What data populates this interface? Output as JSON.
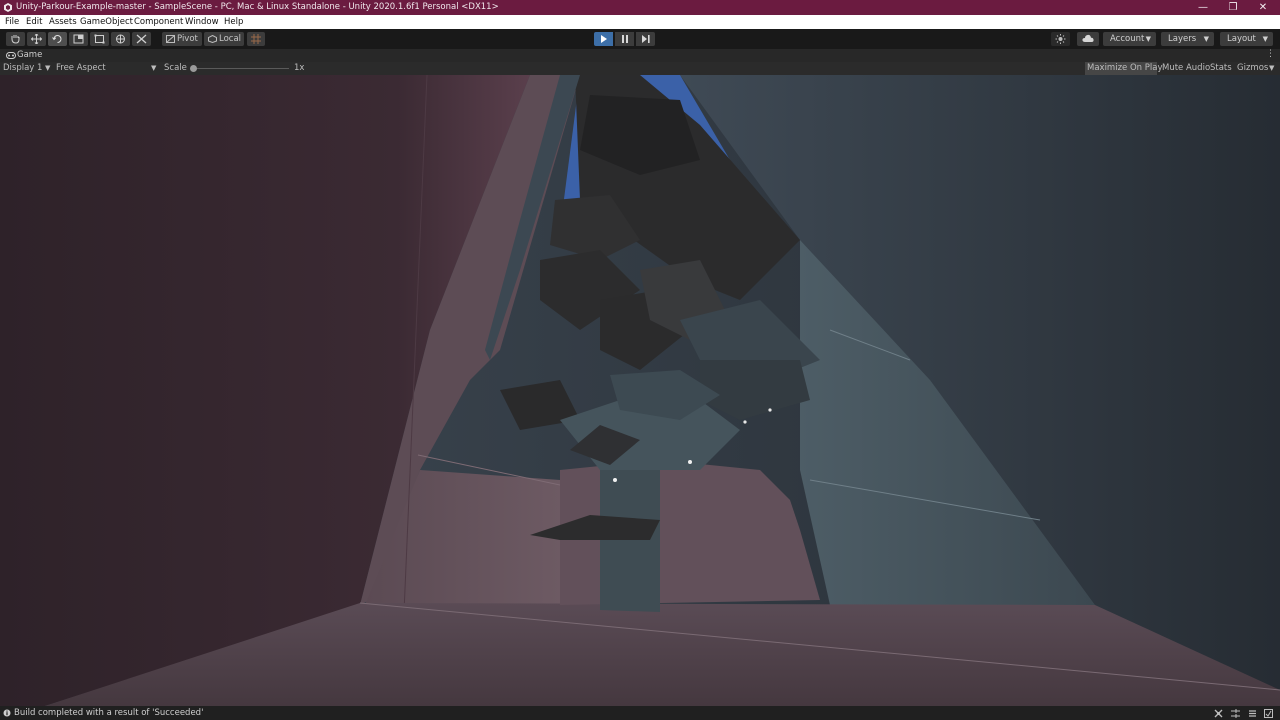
{
  "window": {
    "title": "Unity-Parkour-Example-master - SampleScene - PC, Mac & Linux Standalone - Unity 2020.1.6f1 Personal <DX11>",
    "minimize_glyph": "—",
    "maximize_glyph": "❐",
    "close_glyph": "✕"
  },
  "menu": [
    "File",
    "Edit",
    "Assets",
    "GameObject",
    "Component",
    "Window",
    "Help"
  ],
  "toolbar": {
    "tools": [
      "hand-tool-icon",
      "move-tool-icon",
      "rotate-tool-icon",
      "scale-tool-icon",
      "rect-tool-icon",
      "transform-tool-icon",
      "custom-tool-icon"
    ],
    "active_tool": "rotate-tool-icon",
    "pivot_label": "Pivot",
    "local_label": "Local",
    "play_active": true,
    "account_label": "Account",
    "layers_label": "Layers",
    "layout_label": "Layout"
  },
  "tab": {
    "label": "Game"
  },
  "game_bar": {
    "display": "Display 1",
    "aspect": "Free Aspect",
    "scale_label": "Scale",
    "scale_value": "1x",
    "scale_fraction": 0.0,
    "maximize_on_play": "Maximize On Play",
    "mute_audio": "Mute Audio",
    "stats": "Stats",
    "gizmos": "Gizmos"
  },
  "status": {
    "message": "Build completed with a result of 'Succeeded'"
  },
  "colors": {
    "titlebar": "#6b1b40",
    "play_active": "#3d6fa8",
    "sky": "#3b61a8"
  }
}
